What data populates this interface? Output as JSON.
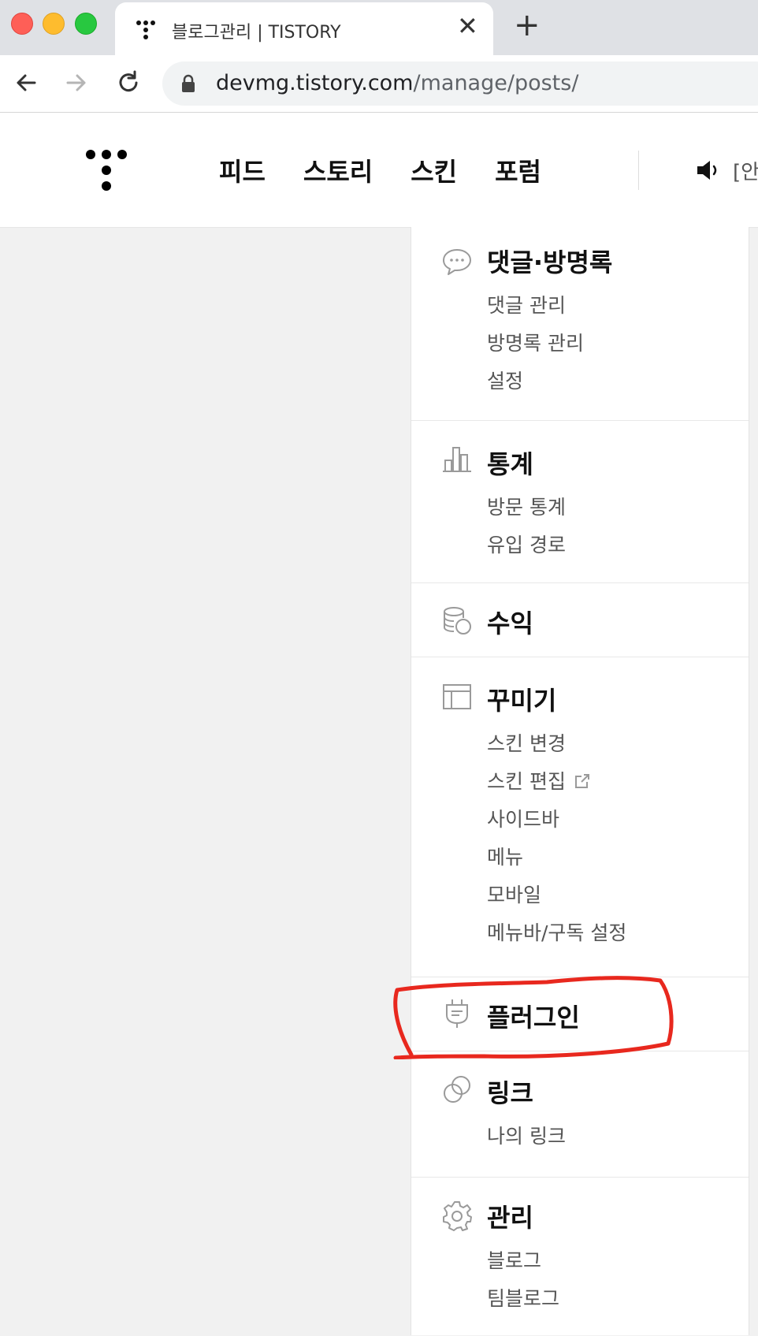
{
  "browser": {
    "tab_title": "블로그관리 | TISTORY",
    "url_host": "devmg.tistory.com",
    "url_path": "/manage/posts/"
  },
  "header": {
    "nav": [
      "피드",
      "스토리",
      "스킨",
      "포럼"
    ],
    "notice": "[안"
  },
  "sidebar": {
    "sections": [
      {
        "icon": "speech-bubble-icon",
        "title": "댓글·방명록",
        "items": [
          "댓글 관리",
          "방명록 관리",
          "설정"
        ]
      },
      {
        "icon": "bar-chart-icon",
        "title": "통계",
        "items": [
          "방문 통계",
          "유입 경로"
        ]
      },
      {
        "icon": "coins-icon",
        "title": "수익",
        "items": []
      },
      {
        "icon": "layout-icon",
        "title": "꾸미기",
        "items": [
          "스킨 변경",
          "스킨 편집",
          "사이드바",
          "메뉴",
          "모바일",
          "메뉴바/구독 설정"
        ]
      },
      {
        "icon": "plug-icon",
        "title": "플러그인",
        "items": []
      },
      {
        "icon": "link-icon",
        "title": "링크",
        "items": [
          "나의 링크"
        ]
      },
      {
        "icon": "gear-icon",
        "title": "관리",
        "items": [
          "블로그",
          "팀블로그"
        ]
      }
    ]
  },
  "annotation": {
    "color": "#e8281e",
    "target": "플러그인"
  }
}
